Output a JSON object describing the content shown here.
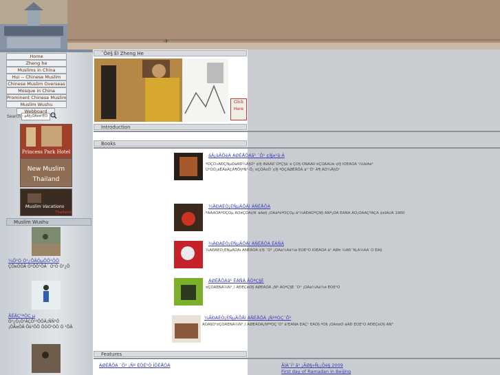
{
  "nav": [
    "Home",
    "Zheng he",
    "Muslims in China",
    "Hui -- Chinese Muslim",
    "Chinese Muslim Overseas",
    "Mosque in China",
    "Prominent Chinese Muslim",
    "Muslim Wushu",
    "Webboard"
  ],
  "search": {
    "label": "Search :",
    "value": "- µÃ§¡ÒÃ¤é¹ËÒ -"
  },
  "banners": [
    {
      "text": "Princess Park Hotel"
    },
    {
      "text1": "New Muslim",
      "text2": "Thailand"
    },
    {
      "text": "Muslim Vacations",
      "sub": "Thailand"
    }
  ],
  "sidebar_section": "Muslim Wushu",
  "side_items": [
    {
      "title": "¾Ô¹Ò Ò¹¿ÕÂÒµÕÕ¹ÕÕ",
      "desc": "ÇÔ¤ÒÒÃ Ò¹ÕÕ¹ÕÂ´ Ò¹Ò Ò¹¿Õ"
    },
    {
      "title": "ÃËÂÇ¹ªÒÇ µ",
      "desc": "Ò¹¿Ò¡Ò¹ÃÇÔ¹¹ÔÕÂ¡ÑÑ¹Õ ¡ÒÃ¤ÒÂ·Õè¹ÕÕ ÕÒÕ¹ÒÕ Ò ¹ÕÂ"
    }
  ],
  "zheng_he_head": "¨Ôé§ ËÍ Zheng He",
  "click_here": [
    "Click",
    "Here"
  ],
  "introduction": "Introduction",
  "books_head": "Books",
  "books": [
    {
      "title": "áÃ¡àÃÔèÁ ÁØÊÅÔÁã¹ ¨Õ¹ ¢Í§¤¹ä·Â",
      "desc": "ªÕÇÔ»ÃÐÇÑµÔáÅÐ¼Å§Ò¹ ¢Í§ ÍÑÅÅÍÎ¨ÕºÇ§ä´é ÇÒ§ ÒÑÅÅÍÎ ¤ÇÒÁÃÙé ¢Í§ ÍÔÊÅÒÁ ¼ÙéÃè¹ Ù¹ÒÕ¡ãËÁèÃÇÁ¶Ö§ºÑ¹·Ö¡ ¤ÇÒÁ¤Ô´¢Í§ ªÒÇÁØÊÅÔÁ ã¹¨Õ¹ Ã¶ ÁÕ¼Å§Ò¹"
    },
    {
      "title": "¾ÃÐÁËÒ¡ÉÑµÃÔÂì ÁÑÊÅÔÁ",
      "desc": "ºÃÃÂÒÂªÕÇÔµ ÁÕ¤ÇÒÁ¢Ñ´áÂé§ ¡ÒÃãªéªÕÇÔµ ã¹¾ÃÐÃÒªÇÑ§ ÃÑª¡ÒÅ ÊÁÑÂ ÁÕ¡ÒÃÃÇºÃÇÁ ¢éÍÁÙÅ 1960"
    },
    {
      "title": "¾ÃÐÁËÒ¡ÉÑµÃÔÂì ÁÑÊÅÔÁ ÊÁÑÂ",
      "desc": "¾ÃÐÁËÒ¡ÉÑµÃÔÂì ÁÑÊÅÔÁ ¢Í§ ¨Õ¹ ¡ÒÃà¼Âá¼è ÈÒÊ¹Ò ÍÔÊÅÒÁ ã¹ ÂØ¤ ¾ÃÐ¨Ñ¡Ã¾ÃÃ´Ô ËÂ§"
    },
    {
      "title": "ÁØÊÅÔÁã¹ ÊÁÑÂ ÃÒªÇ§È",
      "desc": "¤ÇÒÁÊÑÁ¾Ñ¹¸ì ÃÐËÇèÒ§ ÁØÊÅÔÁ ¡Ñº ÃÒªÇ§È ¨Õ¹ ¡ÒÃà¼Âá¼è ÈÒÊ¹Ò"
    },
    {
      "title": "¾ÃÐÁËÒ¡ÉÑµÃÔÂì ÁÑÊÅÔÁ ¡ÑºªÒÇ¨Õ¹",
      "desc": "ÃÒÂ§Ò¹¤ÇÒÁÊÑÁ¾Ñ¹¸ì ÁØÊÅÔÁ¡ÑºªÒÇ¨Õ¹ ã¹ÊÁÑÂ ËÂÇ¹ ËÁÔ§ ªÔ§ ¡ÒÃ¤éÒ áÅÐ ÈÒÊ¹Ò ÃÐËÇèÒ§ ÃÑ°"
    }
  ],
  "features_head": "Features",
  "features": [
    {
      "title": "ÁØÊÅÔÁ ¨Õ¹ ¡Ñº ÈÒÊ¹Ò ÍÔÊÅÒÁ"
    },
    {
      "title": "ÃÍÁ¯Í¹ ã¹ ¡ÃØ§»Ñ¡¡Ôè§ 2009",
      "sub": "First day of Ramadan in Beijing"
    }
  ],
  "colors": {
    "top": "#a98f78",
    "sidebar": "#d3d8dc",
    "right": "#c9ccd0",
    "link": "#3a3ab0"
  }
}
